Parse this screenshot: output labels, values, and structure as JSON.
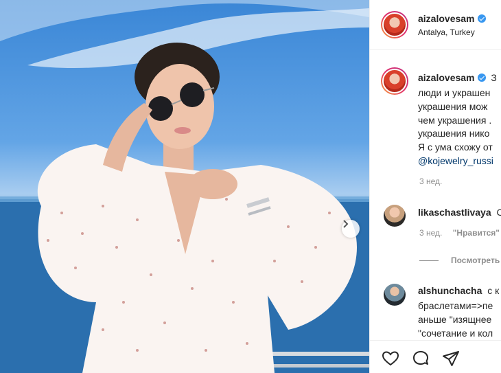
{
  "post": {
    "username": "aizalovesam",
    "location": "Antalya, Turkey"
  },
  "caption": {
    "username": "aizalovesam",
    "first_fragment": "З",
    "lines": [
      "люди и украшен",
      "украшения мож",
      "чем украшения .",
      "украшения нико",
      "Я с ума схожу от"
    ],
    "mention": "@kojewelry_russi",
    "time": "3 нед."
  },
  "comments": [
    {
      "username": "likaschastlivaya",
      "text": "С",
      "time": "3 нед.",
      "like_label": "\"Нравится\""
    },
    {
      "username": "alshunchacha",
      "text": "с к",
      "lines": [
        "браслетами=>пе",
        "аньше \"изящнее",
        "\"сочетание и кол"
      ]
    }
  ],
  "view_replies": "Посмотреть",
  "icons": {
    "verified": "verified-badge-icon",
    "carousel_next": "chevron-right-icon",
    "like": "heart-icon",
    "comment": "comment-bubble-icon",
    "share": "paper-plane-icon"
  },
  "colors": {
    "link": "#00376b",
    "verified": "#3897f0",
    "muted": "#8e8e8e"
  }
}
